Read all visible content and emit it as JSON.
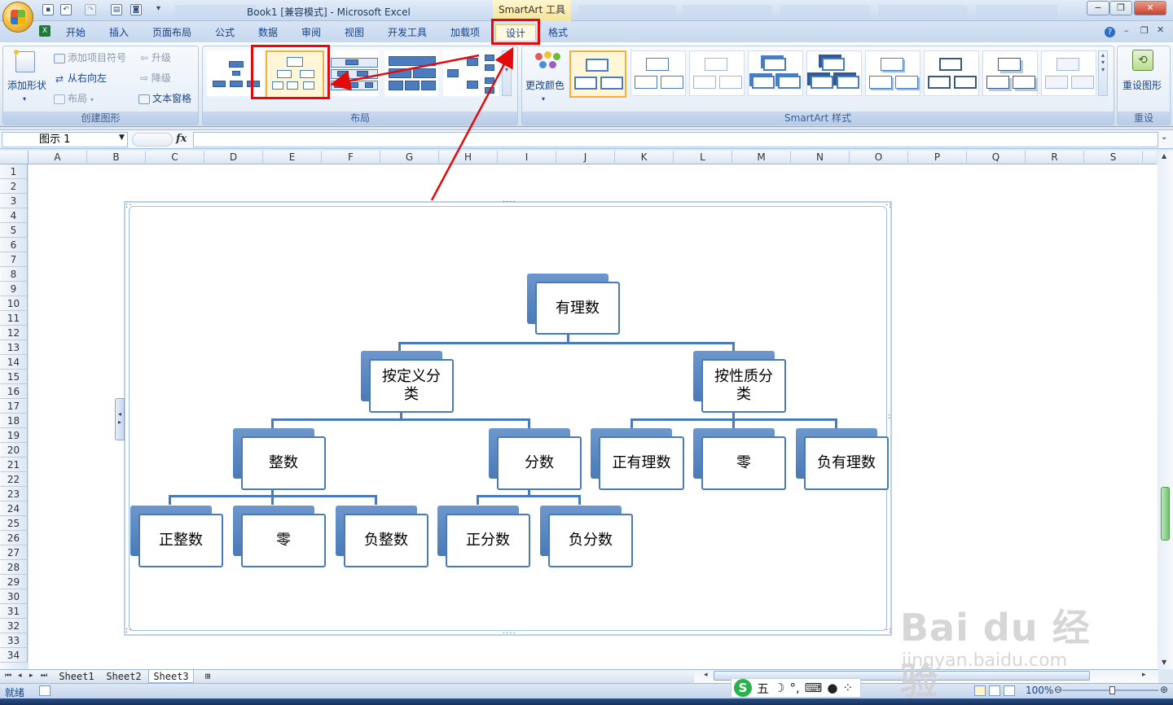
{
  "window": {
    "title": "Book1  [兼容模式] - Microsoft Excel",
    "context_tab_group": "SmartArt 工具",
    "buttons": {
      "minimize": "−",
      "restore": "❐",
      "close": "✕"
    }
  },
  "ribbon_tabs": [
    "开始",
    "插入",
    "页面布局",
    "公式",
    "数据",
    "审阅",
    "视图",
    "开发工具",
    "加载项",
    "设计",
    "格式"
  ],
  "active_tab": "设计",
  "groups": {
    "create_graphic": {
      "label": "创建图形",
      "add_shape": "添加形状",
      "add_bullet": "添加项目符号",
      "right_to_left": "从右向左",
      "layout": "布局",
      "promote": "升级",
      "demote": "降级",
      "text_pane": "文本窗格"
    },
    "layouts": {
      "label": "布局",
      "selected_index": 1
    },
    "smartart_styles": {
      "label": "SmartArt 样式",
      "change_colors": "更改颜色",
      "selected_index": 0
    },
    "reset": {
      "label": "重设",
      "reset_graphic": "重设图形"
    }
  },
  "formula_bar": {
    "name_box": "图示 1",
    "fx": "fx",
    "value": ""
  },
  "columns": [
    "A",
    "B",
    "C",
    "D",
    "E",
    "F",
    "G",
    "H",
    "I",
    "J",
    "K",
    "L",
    "M",
    "N",
    "O",
    "P",
    "Q",
    "R",
    "S"
  ],
  "rows": [
    "1",
    "2",
    "3",
    "4",
    "5",
    "6",
    "7",
    "8",
    "9",
    "10",
    "11",
    "12",
    "13",
    "14",
    "15",
    "16",
    "17",
    "18",
    "19",
    "20",
    "21",
    "22",
    "23",
    "24",
    "25",
    "26",
    "27",
    "28",
    "29",
    "30",
    "31",
    "32",
    "33",
    "34"
  ],
  "smartart": {
    "root": "有理数",
    "level1": [
      "按定义分类",
      "按性质分类"
    ],
    "by_definition": [
      "整数",
      "分数"
    ],
    "integers": [
      "正整数",
      "零",
      "负整数"
    ],
    "fractions": [
      "正分数",
      "负分数"
    ],
    "by_property": [
      "正有理数",
      "零",
      "负有理数"
    ]
  },
  "sheet_tabs": [
    "Sheet1",
    "Sheet2",
    "Sheet3"
  ],
  "active_sheet": "Sheet3",
  "status": {
    "ready": "就绪",
    "zoom": "100%"
  },
  "ime": {
    "mode": "五"
  },
  "watermark": {
    "brand": "Bai du 经验",
    "url": "jingyan.baidu.com"
  },
  "colors": {
    "accent_red": "#e30a0a",
    "node_blue": "#4a7ab8",
    "ribbon_blue": "#15428b"
  }
}
